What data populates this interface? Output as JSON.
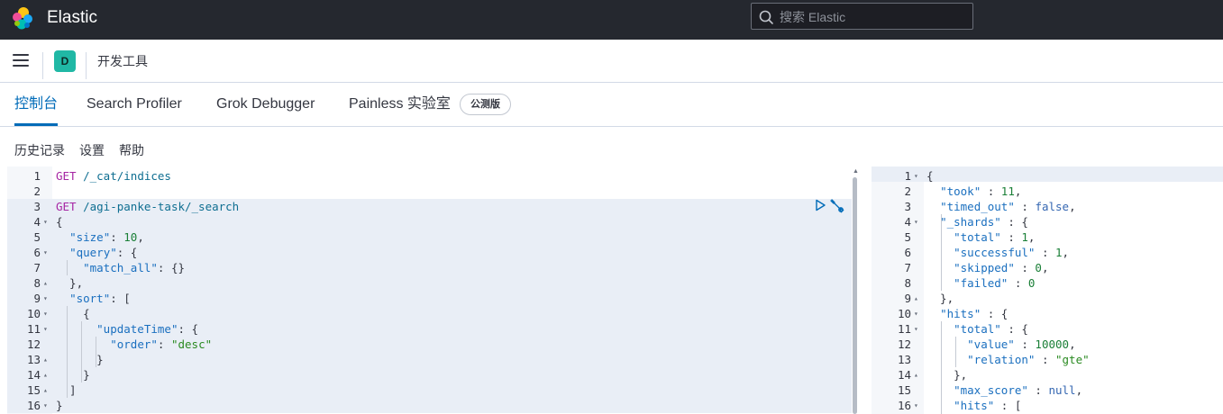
{
  "header": {
    "brand": "Elastic",
    "search_placeholder": "搜索 Elastic",
    "space_initial": "D",
    "page_name": "开发工具"
  },
  "tabs": [
    {
      "label": "控制台",
      "active": true
    },
    {
      "label": "Search Profiler",
      "active": false
    },
    {
      "label": "Grok Debugger",
      "active": false
    },
    {
      "label": "Painless 实验室",
      "active": false
    }
  ],
  "beta_badge": "公测版",
  "toolbar": {
    "history": "历史记录",
    "settings": "设置",
    "help": "帮助"
  },
  "request_editor": {
    "lines": [
      {
        "n": "1",
        "fold": "",
        "text": "GET /_cat/indices"
      },
      {
        "n": "2",
        "fold": "",
        "text": ""
      },
      {
        "n": "3",
        "fold": "",
        "text": "GET /agi-panke-task/_search"
      },
      {
        "n": "4",
        "fold": "▾",
        "text": "{"
      },
      {
        "n": "5",
        "fold": "",
        "text": "  \"size\": 10,"
      },
      {
        "n": "6",
        "fold": "▾",
        "text": "  \"query\": {"
      },
      {
        "n": "7",
        "fold": "",
        "text": "    \"match_all\": {}"
      },
      {
        "n": "8",
        "fold": "▴",
        "text": "  },"
      },
      {
        "n": "9",
        "fold": "▾",
        "text": "  \"sort\": ["
      },
      {
        "n": "10",
        "fold": "▾",
        "text": "    {"
      },
      {
        "n": "11",
        "fold": "▾",
        "text": "      \"updateTime\": {"
      },
      {
        "n": "12",
        "fold": "",
        "text": "        \"order\": \"desc\""
      },
      {
        "n": "13",
        "fold": "▴",
        "text": "      }"
      },
      {
        "n": "14",
        "fold": "▴",
        "text": "    }"
      },
      {
        "n": "15",
        "fold": "▴",
        "text": "  ]"
      },
      {
        "n": "16",
        "fold": "▾",
        "text": "}"
      }
    ]
  },
  "response_editor": {
    "lines": [
      {
        "n": "1",
        "fold": "▾",
        "text": "{"
      },
      {
        "n": "2",
        "fold": "",
        "text": "  \"took\" : 11,"
      },
      {
        "n": "3",
        "fold": "",
        "text": "  \"timed_out\" : false,"
      },
      {
        "n": "4",
        "fold": "▾",
        "text": "  \"_shards\" : {"
      },
      {
        "n": "5",
        "fold": "",
        "text": "    \"total\" : 1,"
      },
      {
        "n": "6",
        "fold": "",
        "text": "    \"successful\" : 1,"
      },
      {
        "n": "7",
        "fold": "",
        "text": "    \"skipped\" : 0,"
      },
      {
        "n": "8",
        "fold": "",
        "text": "    \"failed\" : 0"
      },
      {
        "n": "9",
        "fold": "▴",
        "text": "  },"
      },
      {
        "n": "10",
        "fold": "▾",
        "text": "  \"hits\" : {"
      },
      {
        "n": "11",
        "fold": "▾",
        "text": "    \"total\" : {"
      },
      {
        "n": "12",
        "fold": "",
        "text": "      \"value\" : 10000,"
      },
      {
        "n": "13",
        "fold": "",
        "text": "      \"relation\" : \"gte\""
      },
      {
        "n": "14",
        "fold": "▴",
        "text": "    },"
      },
      {
        "n": "15",
        "fold": "",
        "text": "    \"max_score\" : null,"
      },
      {
        "n": "16",
        "fold": "▾",
        "text": "    \"hits\" : ["
      }
    ]
  },
  "icons": [
    "elastic-logo-icon",
    "search-icon",
    "menu-icon",
    "play-icon",
    "wrench-icon"
  ],
  "colors": {
    "accent": "#006bb8",
    "topbar": "#25282f",
    "space_badge": "#20b8a5"
  }
}
